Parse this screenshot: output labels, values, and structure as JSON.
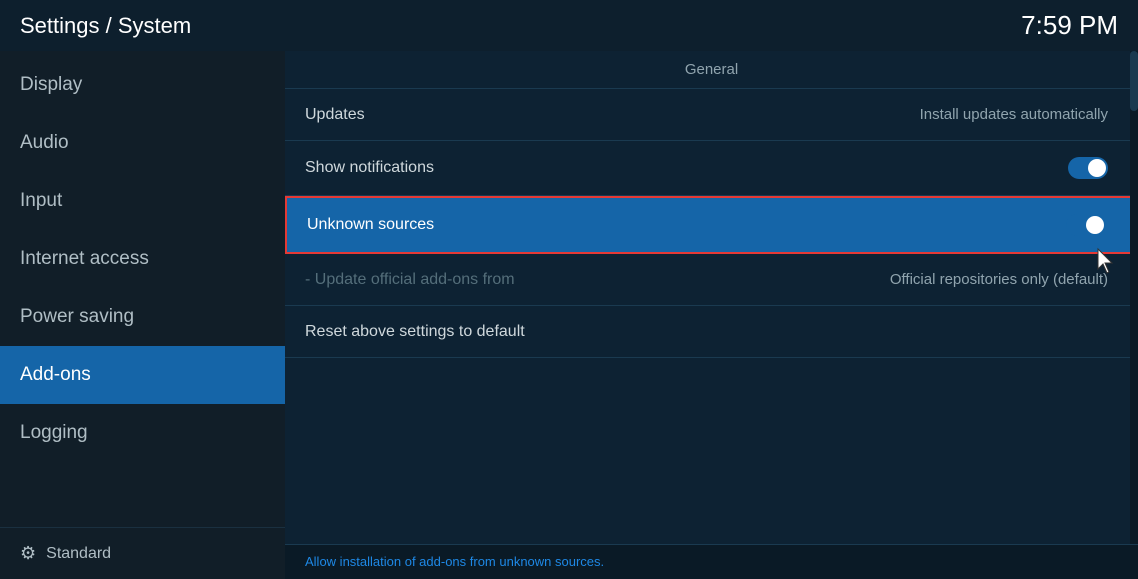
{
  "header": {
    "title": "Settings / System",
    "time": "7:59 PM"
  },
  "sidebar": {
    "items": [
      {
        "id": "display",
        "label": "Display",
        "active": false
      },
      {
        "id": "audio",
        "label": "Audio",
        "active": false
      },
      {
        "id": "input",
        "label": "Input",
        "active": false
      },
      {
        "id": "internet-access",
        "label": "Internet access",
        "active": false
      },
      {
        "id": "power-saving",
        "label": "Power saving",
        "active": false
      },
      {
        "id": "add-ons",
        "label": "Add-ons",
        "active": true
      },
      {
        "id": "logging",
        "label": "Logging",
        "active": false
      }
    ],
    "footer_label": "Standard",
    "footer_icon": "⚙"
  },
  "content": {
    "section_title": "General",
    "settings": [
      {
        "id": "updates",
        "label": "Updates",
        "value": "Install updates automatically",
        "type": "value",
        "highlighted": false,
        "dimmed": false
      },
      {
        "id": "show-notifications",
        "label": "Show notifications",
        "value": "",
        "type": "toggle",
        "toggle_on": true,
        "highlighted": false,
        "dimmed": false
      },
      {
        "id": "unknown-sources",
        "label": "Unknown sources",
        "value": "",
        "type": "toggle",
        "toggle_on": true,
        "highlighted": true,
        "dimmed": false
      },
      {
        "id": "update-official-addons",
        "label": "- Update official add-ons from",
        "value": "Official repositories only (default)",
        "type": "value",
        "highlighted": false,
        "dimmed": true
      },
      {
        "id": "reset-settings",
        "label": "Reset above settings to default",
        "value": "",
        "type": "none",
        "highlighted": false,
        "dimmed": false
      }
    ],
    "bottom_hint": "Allow installation of add-ons from unknown sources."
  }
}
